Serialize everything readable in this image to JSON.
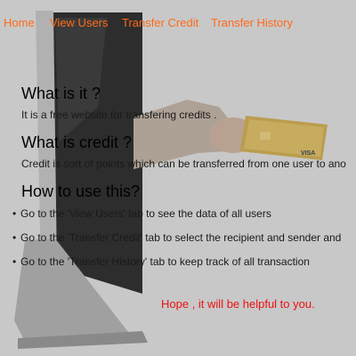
{
  "nav": {
    "items": [
      "Home",
      "View Users",
      "Transfer Credit",
      "Transfer History"
    ]
  },
  "sections": {
    "what": {
      "heading": "What is it ?",
      "text": "It is a free website for transfering credits ."
    },
    "credit": {
      "heading": "What is credit ?",
      "text": "Credit is sort of points which can be transferred from one user to ano"
    },
    "how": {
      "heading": "How to use this?",
      "items": [
        "Go to the 'View Users' tab to see the data of all users",
        "Go to the 'Transfer Credit' tab to select the recipient and sender and",
        "Go to the 'Transfer History' tab to keep track of all transaction"
      ]
    }
  },
  "closing": "Hope , it will be helpful to you.",
  "colors": {
    "nav_link": "#ff6a1a",
    "closing_text": "#ee1111",
    "background": "#d8d8d8"
  },
  "background_image": {
    "icons": [
      "monitor-illustration",
      "hand-holding-credit-card"
    ],
    "card_lettering": "VISA"
  }
}
